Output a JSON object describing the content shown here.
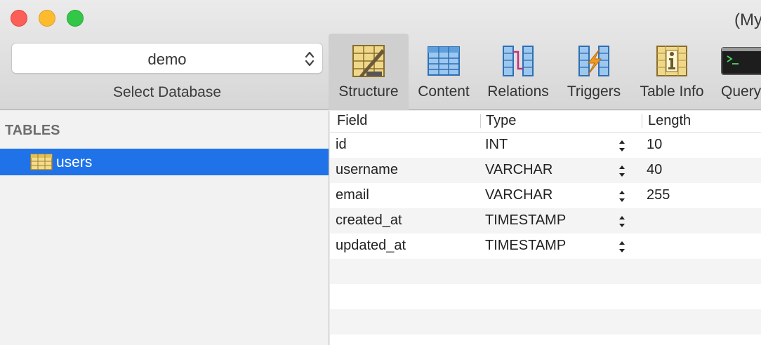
{
  "window": {
    "title": "(My"
  },
  "database": {
    "selected": "demo",
    "label": "Select Database"
  },
  "toolbar": {
    "items": [
      {
        "label": "Structure"
      },
      {
        "label": "Content"
      },
      {
        "label": "Relations"
      },
      {
        "label": "Triggers"
      },
      {
        "label": "Table Info"
      },
      {
        "label": "Query"
      }
    ]
  },
  "sidebar": {
    "header": "TABLES",
    "tables": [
      {
        "name": "users"
      }
    ]
  },
  "structure": {
    "columns": [
      "Field",
      "Type",
      "Length"
    ],
    "rows": [
      {
        "field": "id",
        "type": "INT",
        "length": "10"
      },
      {
        "field": "username",
        "type": "VARCHAR",
        "length": "40"
      },
      {
        "field": "email",
        "type": "VARCHAR",
        "length": "255"
      },
      {
        "field": "created_at",
        "type": "TIMESTAMP",
        "length": ""
      },
      {
        "field": "updated_at",
        "type": "TIMESTAMP",
        "length": ""
      }
    ]
  },
  "colors": {
    "selection": "#1f72e8",
    "close": "#fc5f57",
    "minimize": "#fdbc2e",
    "maximize": "#33c748"
  }
}
